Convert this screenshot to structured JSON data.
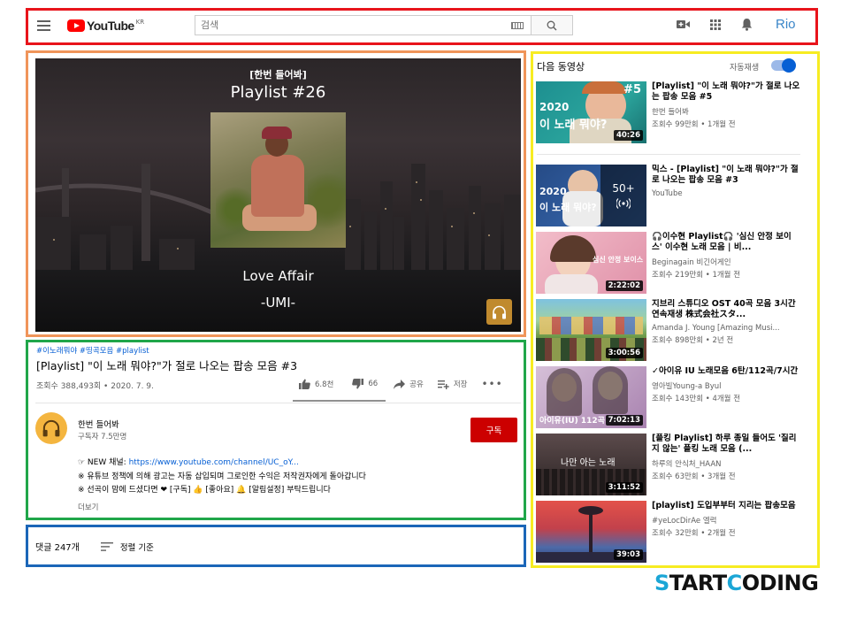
{
  "header": {
    "logo_text": "YouTube",
    "logo_region": "KR",
    "search_placeholder": "검색",
    "account_label": "Rio"
  },
  "player": {
    "tag": "[한번 들어봐]",
    "playlist_title": "Playlist #26",
    "song_title": "Love Affair",
    "artist": "-UMI-"
  },
  "video": {
    "hashtags": "#이노래뭐야 #띵곡모음 #playlist",
    "title": "[Playlist] \"이 노래 뭐야?\"가 절로 나오는 팝송 모음 #3",
    "meta": "조회수 388,493회 • 2020. 7. 9.",
    "likes": "6.8천",
    "dislikes": "66",
    "share_label": "공유",
    "save_label": "저장",
    "like_ratio": 0.99
  },
  "channel": {
    "name": "한번 들어봐",
    "subscribers": "구독자 7.5만명",
    "subscribe_label": "구독"
  },
  "description": {
    "line1_prefix": "☞ NEW 채널: ",
    "line1_link": "https://www.youtube.com/channel/UC_oY...",
    "line2": "※ 유튜브 정책에 의해 광고는 자동 삽입되며 그로인한 수익은 저작권자에게 돌아갑니다",
    "line3": "※ 선곡이 맘에 드셨다면 ❤ [구독] 👍 [좋아요] 🔔 [알림설정] 부탁드립니다",
    "more_label": "더보기"
  },
  "comments": {
    "count_label": "댓글 247개",
    "sort_label": "정렬 기준"
  },
  "sidebar": {
    "up_next_label": "다음 동영상",
    "autoplay_label": "자동재생",
    "autoplay_on": true,
    "items": [
      {
        "title": "[Playlist] \"이 노래 뭐야?\"가 절로 나오는 팝송 모음 #5",
        "channel": "한번 들어봐",
        "meta": "조회수 99만회 • 1개월 전",
        "duration": "40:26",
        "thumb_text": "이 노래 뭐야?",
        "thumb_year": "2020",
        "thumb_no": "#5",
        "thumb_color": "#1e8f93"
      },
      {
        "title": "믹스 - [Playlist] \"이 노래 뭐야?\"가 절로 나오는 팝송 모음 #3",
        "channel": "YouTube",
        "meta": "",
        "duration": "",
        "thumb_text": "이 노래 뭐야?",
        "thumb_year": "2020",
        "mix_count": "50+",
        "thumb_color": "#2c4f8c"
      },
      {
        "title": "🎧이수현 Playlist🎧 '심신 안정 보이스' 이수현 노래 모음 | 비...",
        "channel": "Beginagain 비긴어게인",
        "meta": "조회수 219만회 • 1개월 전",
        "duration": "2:22:02",
        "thumb_text": "심신 안정 보이스",
        "thumb_color": "#e7a0b4"
      },
      {
        "title": "지브리 스튜디오 OST 40곡 모음 3시간 연속재생 株式会社スタ...",
        "channel": "Amanda J. Young [Amazing Musi...",
        "meta": "조회수 898만회 • 2년 전",
        "duration": "3:00:56",
        "thumb_color": "#6f9a4a"
      },
      {
        "title": "✓아이유 IU 노래모음 6탄/112곡/7시간",
        "channel": "영아빌Young-a Byul",
        "meta": "조회수 143만회 • 4개월 전",
        "duration": "7:02:13",
        "thumb_text": "아이유(IU) 112곡",
        "thumb_color": "#b895b9"
      },
      {
        "title": "[플킹 Playlist] 하루 종일 들어도 '질리지 않는' 플킹 노래 모음 (...",
        "channel": "하루의 안식처_HAAN",
        "meta": "조회수 63만회 • 3개월 전",
        "duration": "3:11:52",
        "thumb_text": "나만 아는 노래",
        "thumb_color": "#4a3c3e"
      },
      {
        "title": "[playlist] 도입부부터 지리는 팝송모음",
        "channel": "#yeLocDirAe 엘럭",
        "meta": "조회수 32만회 • 2개월 전",
        "duration": "39:03",
        "thumb_color": "#d1514b"
      }
    ]
  },
  "watermark": {
    "brand_a": "S",
    "brand_b": "TART",
    "brand_c": "C",
    "brand_d": "ODING"
  }
}
